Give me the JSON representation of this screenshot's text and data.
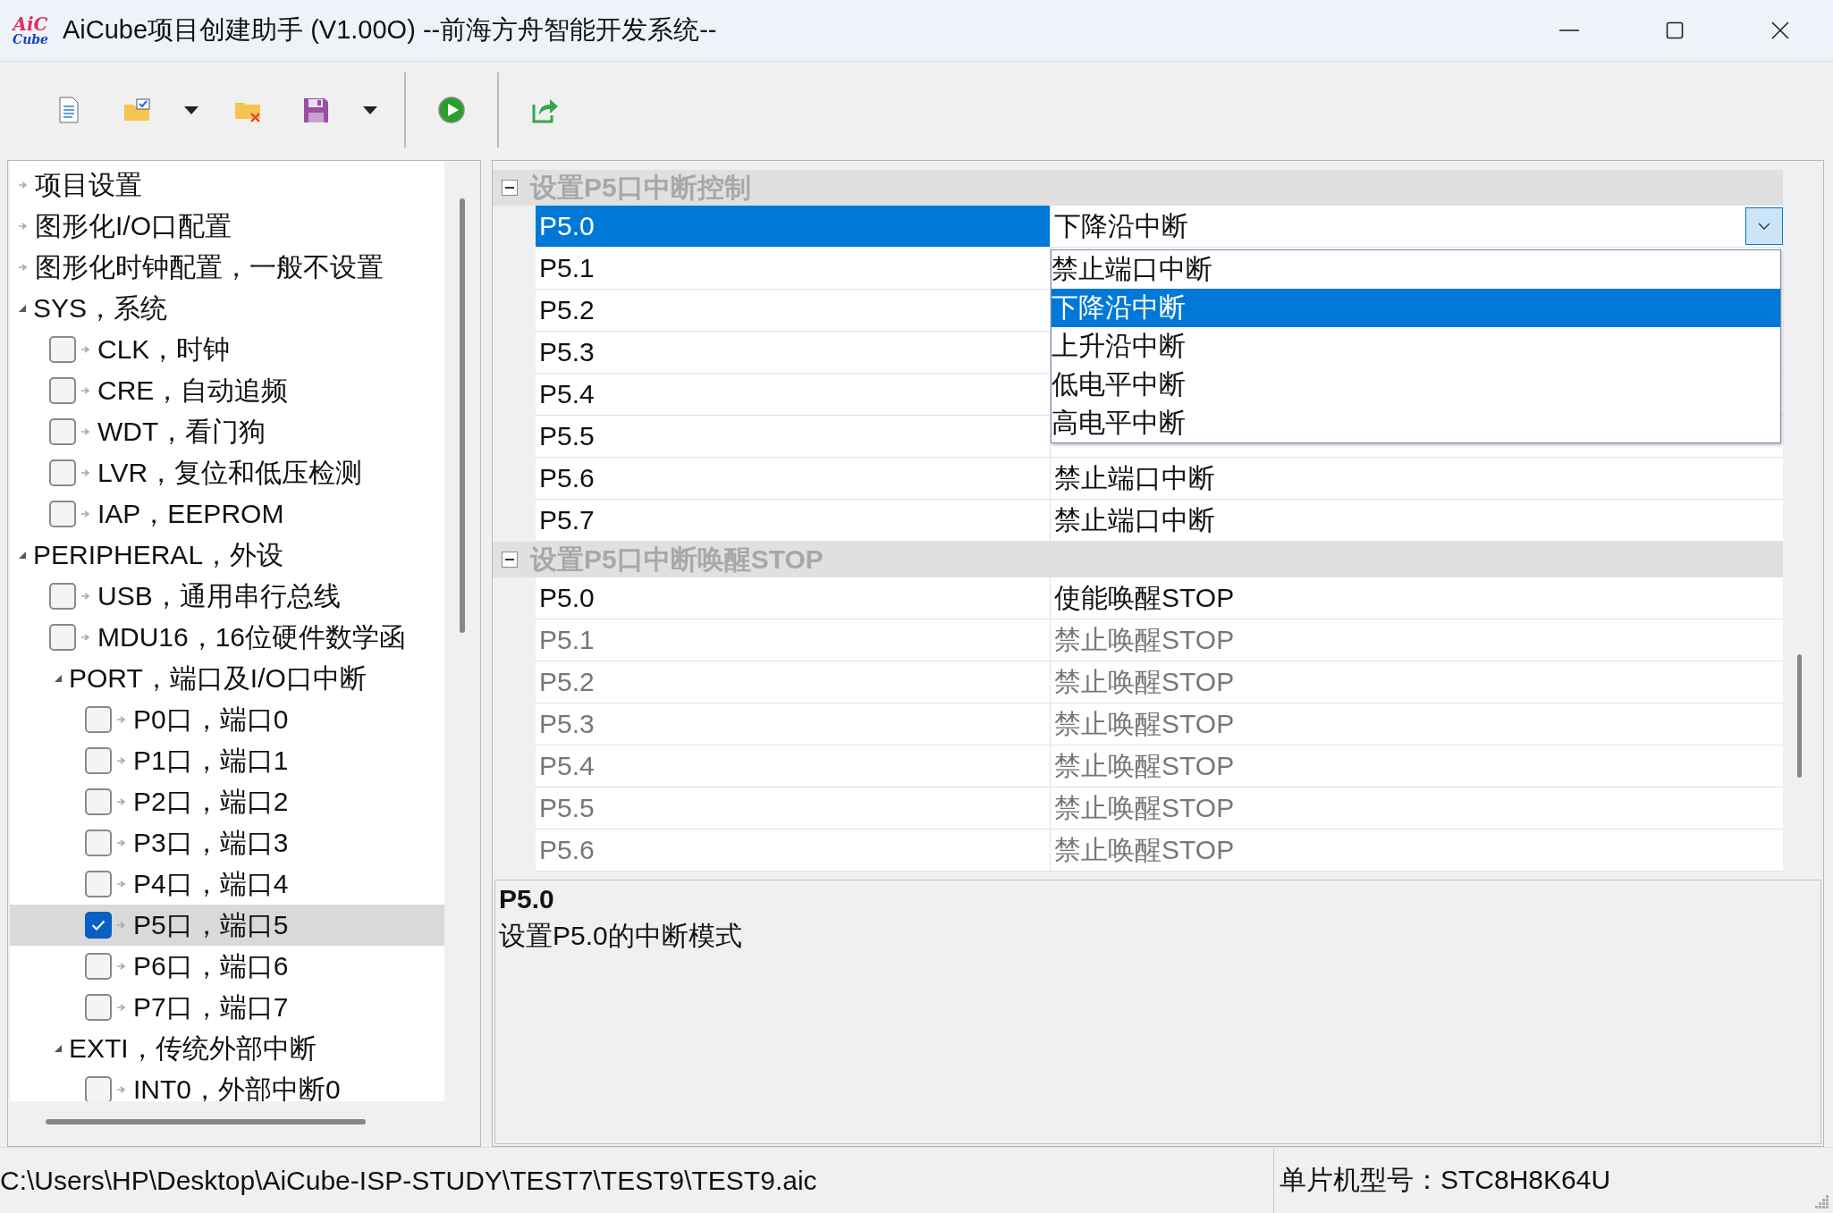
{
  "window": {
    "logo": [
      "AiC",
      "Cube"
    ],
    "title": "AiCube项目创建助手 (V1.00O) --前海方舟智能开发系统--"
  },
  "toolbar": {
    "groups": [
      {
        "items": [
          {
            "kind": "button"
          },
          {
            "kind": "button"
          },
          {
            "kind": "dropdown"
          },
          {
            "kind": "button"
          },
          {
            "kind": "button"
          },
          {
            "kind": "dropdown"
          }
        ]
      },
      {
        "items": [
          {
            "kind": "button"
          }
        ]
      },
      {
        "items": [
          {
            "kind": "button"
          }
        ]
      }
    ]
  },
  "tree": {
    "items": [
      {
        "label": "项目设置",
        "expanded": false,
        "selected": false
      },
      {
        "label": "图形化I/O口配置",
        "expanded": false,
        "selected": false
      },
      {
        "label": "图形化时钟配置，一般不设置",
        "expanded": false,
        "selected": false
      },
      {
        "label": "SYS，系统",
        "expanded": true,
        "selected": false,
        "children": [
          {
            "label": "CLK，时钟",
            "checked": false,
            "selected": false
          },
          {
            "label": "CRE，自动追频",
            "checked": false,
            "selected": false
          },
          {
            "label": "WDT，看门狗",
            "checked": false,
            "selected": false
          },
          {
            "label": "LVR，复位和低压检测",
            "checked": false,
            "selected": false
          },
          {
            "label": "IAP，EEPROM",
            "checked": false,
            "selected": false
          }
        ]
      },
      {
        "label": "PERIPHERAL，外设",
        "expanded": true,
        "selected": false,
        "children": [
          {
            "label": "USB，通用串行总线",
            "checked": false,
            "selected": false
          },
          {
            "label": "MDU16，16位硬件数学函",
            "checked": false,
            "selected": false
          },
          {
            "label": "PORT，端口及I/O口中断",
            "expanded": true,
            "selected": false,
            "children": [
              {
                "label": "P0口，端口0",
                "checked": false,
                "selected": false
              },
              {
                "label": "P1口，端口1",
                "checked": false,
                "selected": false
              },
              {
                "label": "P2口，端口2",
                "checked": false,
                "selected": false
              },
              {
                "label": "P3口，端口3",
                "checked": false,
                "selected": false
              },
              {
                "label": "P4口，端口4",
                "checked": false,
                "selected": false
              },
              {
                "label": "P5口，端口5",
                "checked": true,
                "selected": true
              },
              {
                "label": "P6口，端口6",
                "checked": false,
                "selected": false
              },
              {
                "label": "P7口，端口7",
                "checked": false,
                "selected": false
              }
            ]
          },
          {
            "label": "EXTI，传统外部中断",
            "expanded": true,
            "selected": false,
            "children": [
              {
                "label": "INT0，外部中断0",
                "checked": false,
                "selected": false
              }
            ]
          }
        ]
      }
    ]
  },
  "grid": {
    "sections": [
      {
        "title": "设置P5口中断控制",
        "expanded": true,
        "rows": [
          {
            "name": "P5.0",
            "value": "下降沿中断",
            "selected": true,
            "disabled": false,
            "open": true
          },
          {
            "name": "P5.1",
            "selected": false,
            "disabled": false
          },
          {
            "name": "P5.2",
            "selected": false,
            "disabled": false
          },
          {
            "name": "P5.3",
            "selected": false,
            "disabled": false
          },
          {
            "name": "P5.4",
            "selected": false,
            "disabled": false
          },
          {
            "name": "P5.5",
            "selected": false,
            "disabled": false
          },
          {
            "name": "P5.6",
            "value": "禁止端口中断",
            "selected": false,
            "disabled": false
          },
          {
            "name": "P5.7",
            "value": "禁止端口中断",
            "selected": false,
            "disabled": false
          }
        ]
      },
      {
        "title": "设置P5口中断唤醒STOP",
        "expanded": true,
        "rows": [
          {
            "name": "P5.0",
            "value": "使能唤醒STOP",
            "selected": false,
            "disabled": false
          },
          {
            "name": "P5.1",
            "value": "禁止唤醒STOP",
            "selected": false,
            "disabled": true
          },
          {
            "name": "P5.2",
            "value": "禁止唤醒STOP",
            "selected": false,
            "disabled": true
          },
          {
            "name": "P5.3",
            "value": "禁止唤醒STOP",
            "selected": false,
            "disabled": true
          },
          {
            "name": "P5.4",
            "value": "禁止唤醒STOP",
            "selected": false,
            "disabled": true
          },
          {
            "name": "P5.5",
            "value": "禁止唤醒STOP",
            "selected": false,
            "disabled": true
          },
          {
            "name": "P5.6",
            "value": "禁止唤醒STOP",
            "selected": false,
            "disabled": true
          }
        ]
      }
    ],
    "dropdown": {
      "options": [
        {
          "label": "禁止端口中断",
          "selected": false
        },
        {
          "label": "下降沿中断",
          "selected": true
        },
        {
          "label": "上升沿中断",
          "selected": false
        },
        {
          "label": "低电平中断",
          "selected": false
        },
        {
          "label": "高电平中断",
          "selected": false
        }
      ]
    }
  },
  "description": {
    "title": "P5.0",
    "text": "设置P5.0的中断模式"
  },
  "status_bar": {
    "path": "C:\\Users\\HP\\Desktop\\AiCube-ISP-STUDY\\TEST7\\TEST9\\TEST9.aic",
    "model": "单片机型号：STC8H8K64U"
  }
}
